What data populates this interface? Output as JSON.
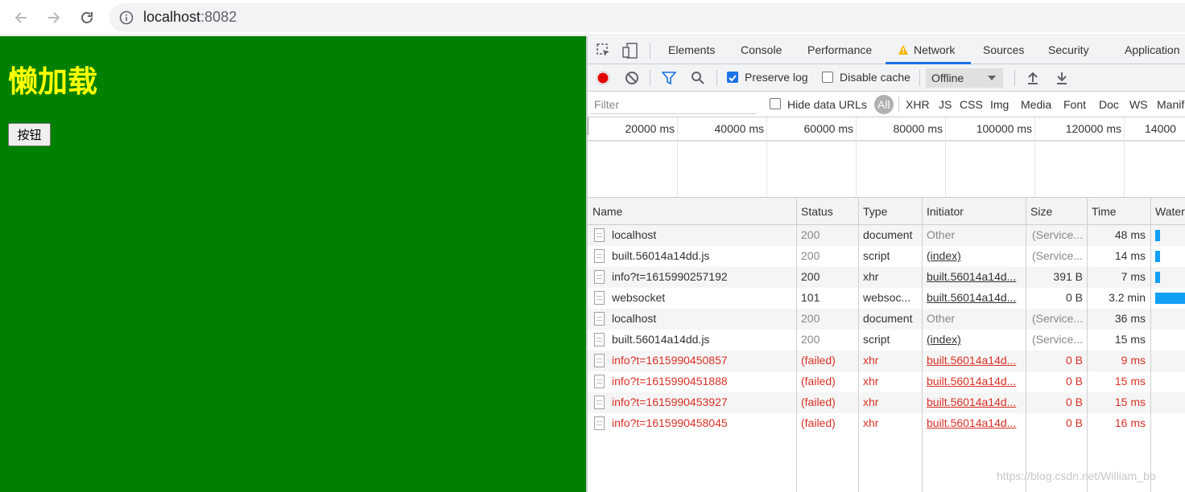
{
  "browser": {
    "url_host": "localhost",
    "url_port": ":8082"
  },
  "page": {
    "title": "懒加载",
    "button_label": "按钮",
    "background": "#008000",
    "title_color": "#ffff00"
  },
  "devtools": {
    "tabs": [
      "Elements",
      "Console",
      "Performance",
      "Network",
      "Sources",
      "Security",
      "Application"
    ],
    "active_tab": "Network",
    "toolbar": {
      "preserve_log_label": "Preserve log",
      "preserve_log_checked": true,
      "disable_cache_label": "Disable cache",
      "disable_cache_checked": false,
      "throttle_value": "Offline"
    },
    "filterbar": {
      "filter_placeholder": "Filter",
      "hide_data_urls_label": "Hide data URLs",
      "types": [
        "All",
        "XHR",
        "JS",
        "CSS",
        "Img",
        "Media",
        "Font",
        "Doc",
        "WS",
        "Manif"
      ]
    },
    "overview_ticks": [
      "20000 ms",
      "40000 ms",
      "60000 ms",
      "80000 ms",
      "100000 ms",
      "120000 ms",
      "14000"
    ],
    "columns": [
      "Name",
      "Status",
      "Type",
      "Initiator",
      "Size",
      "Time",
      "Water"
    ],
    "rows": [
      {
        "name": "localhost",
        "status": "200",
        "type": "document",
        "initiator": "Other",
        "size": "(Service...",
        "time": "48 ms",
        "failed": false,
        "initiator_link": false,
        "dim_status": true,
        "dim_size": true,
        "waterfall": 0.15
      },
      {
        "name": "built.56014a14dd.js",
        "status": "200",
        "type": "script",
        "initiator": "(index)",
        "size": "(Service...",
        "time": "14 ms",
        "failed": false,
        "initiator_link": true,
        "dim_status": true,
        "dim_size": true,
        "waterfall": 0.15
      },
      {
        "name": "info?t=1615990257192",
        "status": "200",
        "type": "xhr",
        "initiator": "built.56014a14d...",
        "size": "391 B",
        "time": "7 ms",
        "failed": false,
        "initiator_link": true,
        "dim_status": false,
        "dim_size": false,
        "waterfall": 0.15
      },
      {
        "name": "websocket",
        "status": "101",
        "type": "websoc...",
        "initiator": "built.56014a14d...",
        "size": "0 B",
        "time": "3.2 min",
        "failed": false,
        "initiator_link": true,
        "dim_status": false,
        "dim_size": false,
        "waterfall": 1.0
      },
      {
        "name": "localhost",
        "status": "200",
        "type": "document",
        "initiator": "Other",
        "size": "(Service...",
        "time": "36 ms",
        "failed": false,
        "initiator_link": false,
        "dim_status": true,
        "dim_size": true,
        "waterfall": 0
      },
      {
        "name": "built.56014a14dd.js",
        "status": "200",
        "type": "script",
        "initiator": "(index)",
        "size": "(Service...",
        "time": "15 ms",
        "failed": false,
        "initiator_link": true,
        "dim_status": true,
        "dim_size": true,
        "waterfall": 0
      },
      {
        "name": "info?t=1615990450857",
        "status": "(failed)",
        "type": "xhr",
        "initiator": "built.56014a14d...",
        "size": "0 B",
        "time": "9 ms",
        "failed": true,
        "initiator_link": true,
        "dim_status": false,
        "dim_size": false,
        "waterfall": 0
      },
      {
        "name": "info?t=1615990451888",
        "status": "(failed)",
        "type": "xhr",
        "initiator": "built.56014a14d...",
        "size": "0 B",
        "time": "15 ms",
        "failed": true,
        "initiator_link": true,
        "dim_status": false,
        "dim_size": false,
        "waterfall": 0
      },
      {
        "name": "info?t=1615990453927",
        "status": "(failed)",
        "type": "xhr",
        "initiator": "built.56014a14d...",
        "size": "0 B",
        "time": "15 ms",
        "failed": true,
        "initiator_link": true,
        "dim_status": false,
        "dim_size": false,
        "waterfall": 0
      },
      {
        "name": "info?t=1615990458045",
        "status": "(failed)",
        "type": "xhr",
        "initiator": "built.56014a14d...",
        "size": "0 B",
        "time": "16 ms",
        "failed": true,
        "initiator_link": true,
        "dim_status": false,
        "dim_size": false,
        "waterfall": 0
      }
    ]
  },
  "watermark": "https://blog.csdn.net/William_bb"
}
